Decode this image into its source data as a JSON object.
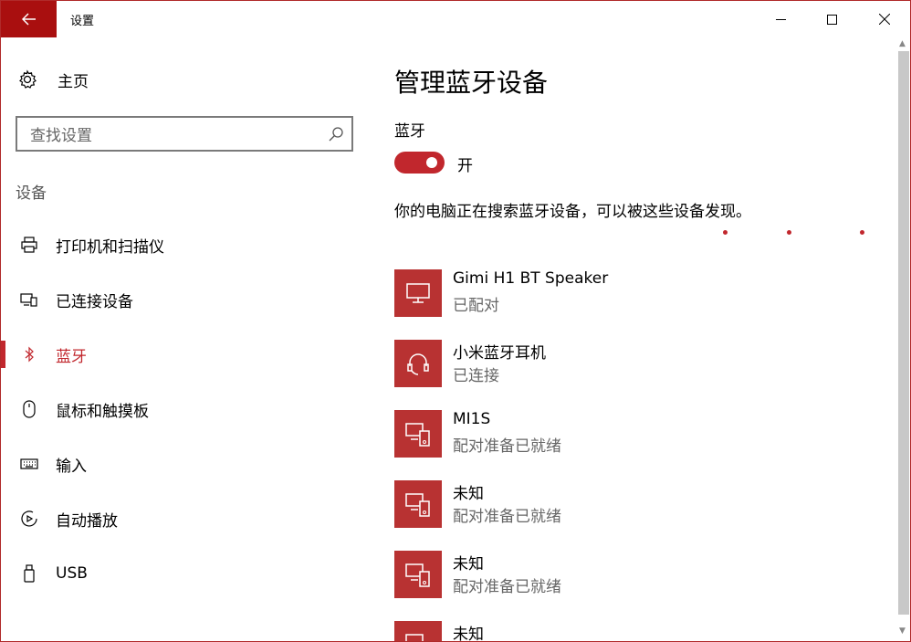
{
  "window": {
    "title": "设置"
  },
  "sidebar": {
    "home_label": "主页",
    "search_placeholder": "查找设置",
    "section_label": "设备",
    "items": [
      {
        "label": "打印机和扫描仪",
        "icon": "printer-icon",
        "active": false
      },
      {
        "label": "已连接设备",
        "icon": "connected-devices-icon",
        "active": false
      },
      {
        "label": "蓝牙",
        "icon": "bluetooth-icon",
        "active": true
      },
      {
        "label": "鼠标和触摸板",
        "icon": "mouse-icon",
        "active": false
      },
      {
        "label": "输入",
        "icon": "keyboard-icon",
        "active": false
      },
      {
        "label": "自动播放",
        "icon": "autoplay-icon",
        "active": false
      },
      {
        "label": "USB",
        "icon": "usb-icon",
        "active": false
      }
    ]
  },
  "main": {
    "title": "管理蓝牙设备",
    "bluetooth_label": "蓝牙",
    "toggle_state": "开",
    "description": "你的电脑正在搜索蓝牙设备，可以被这些设备发现。",
    "devices": [
      {
        "name": "Gimi H1 BT Speaker",
        "status": "已配对",
        "icon": "monitor-icon"
      },
      {
        "name": "小米蓝牙耳机",
        "status": "已连接",
        "icon": "headset-icon"
      },
      {
        "name": "MI1S",
        "status": "配对准备已就绪",
        "icon": "phone-device-icon"
      },
      {
        "name": "未知",
        "status": "配对准备已就绪",
        "icon": "phone-device-icon"
      },
      {
        "name": "未知",
        "status": "配对准备已就绪",
        "icon": "phone-device-icon"
      },
      {
        "name": "未知",
        "status": "",
        "icon": "phone-device-icon"
      }
    ]
  },
  "colors": {
    "accent": "#c1272d",
    "titlebar_back": "#a90f0f",
    "device_tile": "#b83232"
  }
}
